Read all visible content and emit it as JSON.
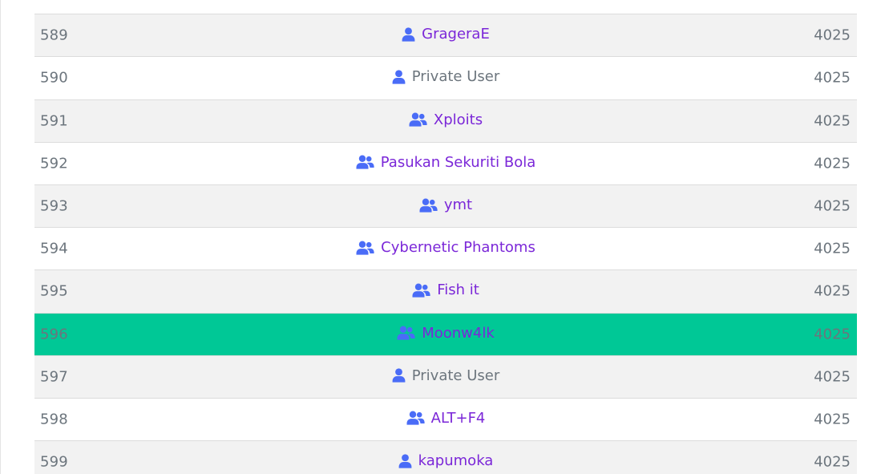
{
  "colors": {
    "link": "#7b27d8",
    "icon": "#4a6cf7",
    "text_muted": "#6c757d",
    "row_odd": "#f2f2f2",
    "row_even": "#ffffff",
    "highlight": "#00c896"
  },
  "scoreboard": {
    "rows": [
      {
        "rank": "",
        "name": "",
        "icon": "users-icon",
        "score": "",
        "link": true,
        "highlight": false
      },
      {
        "rank": "589",
        "name": "GrageraE",
        "icon": "user-icon",
        "score": "4025",
        "link": true,
        "highlight": false
      },
      {
        "rank": "590",
        "name": "Private User",
        "icon": "user-icon",
        "score": "4025",
        "link": false,
        "highlight": false
      },
      {
        "rank": "591",
        "name": "Xploits",
        "icon": "users-icon",
        "score": "4025",
        "link": true,
        "highlight": false
      },
      {
        "rank": "592",
        "name": "Pasukan Sekuriti Bola",
        "icon": "users-icon",
        "score": "4025",
        "link": true,
        "highlight": false
      },
      {
        "rank": "593",
        "name": "ymt",
        "icon": "users-icon",
        "score": "4025",
        "link": true,
        "highlight": false
      },
      {
        "rank": "594",
        "name": "Cybernetic Phantoms",
        "icon": "users-icon",
        "score": "4025",
        "link": true,
        "highlight": false
      },
      {
        "rank": "595",
        "name": "Fish it",
        "icon": "users-icon",
        "score": "4025",
        "link": true,
        "highlight": false
      },
      {
        "rank": "596",
        "name": "Moonw4lk",
        "icon": "users-icon",
        "score": "4025",
        "link": true,
        "highlight": true
      },
      {
        "rank": "597",
        "name": "Private User",
        "icon": "user-icon",
        "score": "4025",
        "link": false,
        "highlight": false
      },
      {
        "rank": "598",
        "name": "ALT+F4",
        "icon": "users-icon",
        "score": "4025",
        "link": true,
        "highlight": false
      },
      {
        "rank": "599",
        "name": "kapumoka",
        "icon": "user-icon",
        "score": "4025",
        "link": true,
        "highlight": false
      }
    ]
  }
}
